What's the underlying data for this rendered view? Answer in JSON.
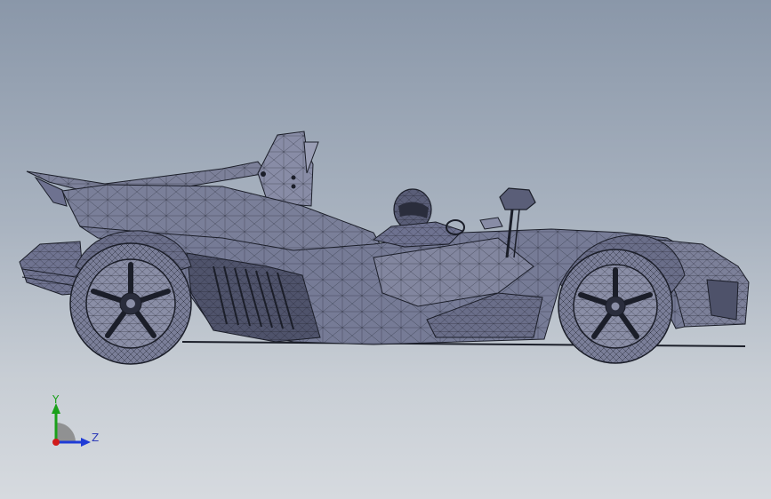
{
  "viewport": {
    "background_top": "#8a97a9",
    "background_bottom": "#d6dadf",
    "model_fill": "#767b96",
    "model_fill_light": "#8d91a9",
    "model_fill_dark": "#4e526a",
    "wire_color": "#1b1e29"
  },
  "triad": {
    "y_label": "Y",
    "z_label": "Z",
    "y_color": "#1aa01a",
    "z_color": "#1f3bd6",
    "x_color": "#d01a1a",
    "label_color": "#2e3bb8"
  }
}
